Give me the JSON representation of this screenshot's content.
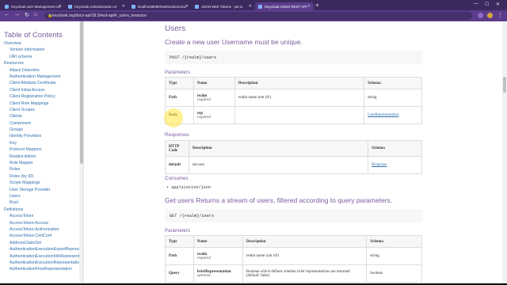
{
  "browser": {
    "tabs": [
      {
        "label": "Keycloak user Management Us",
        "active": false
      },
      {
        "label": "Keycloak Administration UI",
        "active": false
      },
      {
        "label": "localhost8090/realms/demo/ac",
        "active": false
      },
      {
        "label": "JSON Web Tokens - jwt.io",
        "active": false
      },
      {
        "label": "Keycloak Admin REST API",
        "active": true
      }
    ],
    "url": "keycloak.org/docs-api/18.0/rest-api/#_users_resource"
  },
  "sidebar": {
    "title": "Table of Contents",
    "items": [
      {
        "label": "Overview",
        "level": 1
      },
      {
        "label": "Version information",
        "level": 2
      },
      {
        "label": "URI scheme",
        "level": 2
      },
      {
        "label": "Resources",
        "level": 1
      },
      {
        "label": "Attack Detection",
        "level": 2
      },
      {
        "label": "Authentication Management",
        "level": 2
      },
      {
        "label": "Client Attribute Certificate",
        "level": 2
      },
      {
        "label": "Client Initial Access",
        "level": 2
      },
      {
        "label": "Client Registration Policy",
        "level": 2
      },
      {
        "label": "Client Role Mappings",
        "level": 2
      },
      {
        "label": "Client Scopes",
        "level": 2
      },
      {
        "label": "Clients",
        "level": 2
      },
      {
        "label": "Component",
        "level": 2
      },
      {
        "label": "Groups",
        "level": 2
      },
      {
        "label": "Identity Providers",
        "level": 2
      },
      {
        "label": "Key",
        "level": 2
      },
      {
        "label": "Protocol Mappers",
        "level": 2
      },
      {
        "label": "Realms Admin",
        "level": 2
      },
      {
        "label": "Role Mapper",
        "level": 2
      },
      {
        "label": "Roles",
        "level": 2
      },
      {
        "label": "Roles (by ID)",
        "level": 2
      },
      {
        "label": "Scope Mappings",
        "level": 2
      },
      {
        "label": "User Storage Provider",
        "level": 2
      },
      {
        "label": "Users",
        "level": 2
      },
      {
        "label": "Root",
        "level": 2
      },
      {
        "label": "Definitions",
        "level": 1
      },
      {
        "label": "AccessToken",
        "level": 2
      },
      {
        "label": "AccessToken-Access",
        "level": 2
      },
      {
        "label": "AccessToken-Authorization",
        "level": 2
      },
      {
        "label": "AccessToken-CertConf",
        "level": 2
      },
      {
        "label": "AddressClaimSet",
        "level": 2
      },
      {
        "label": "AuthenticationExecutionExportRepresentation",
        "level": 2
      },
      {
        "label": "AuthenticationExecutionInfoRepresentation",
        "level": 2
      },
      {
        "label": "AuthenticationExecutionRepresentation",
        "level": 2
      },
      {
        "label": "AuthenticationFlowRepresentation",
        "level": 2
      }
    ]
  },
  "main": {
    "section_title": "Users",
    "create": {
      "title": "Create a new user Username must be unique.",
      "endpoint": "POST /{realm}/users",
      "params_title": "Parameters",
      "params_headers": [
        "Type",
        "Name",
        "Description",
        "Schema"
      ],
      "params_rows": [
        {
          "type": "Path",
          "name": "realm",
          "required": "required",
          "description": "realm name (not id!)",
          "schema": "string"
        },
        {
          "type": "Body",
          "name": "rep",
          "required": "required",
          "description": "",
          "schema": "UserRepresentation"
        }
      ],
      "responses_title": "Responses",
      "responses_headers": [
        "HTTP Code",
        "Description",
        "Schema"
      ],
      "responses_rows": [
        {
          "code": "default",
          "description": "success",
          "schema": "Response"
        }
      ],
      "consumes_title": "Consumes",
      "consumes": "application/json"
    },
    "get": {
      "title": "Get users Returns a stream of users, filtered according to query parameters.",
      "endpoint": "GET /{realm}/users",
      "params_title": "Parameters",
      "params_headers": [
        "Type",
        "Name",
        "Description",
        "Schema"
      ],
      "params_rows": [
        {
          "type": "Path",
          "name": "realm",
          "required": "required",
          "description": "realm name (not id!)",
          "schema": "string"
        },
        {
          "type": "Query",
          "name": "briefRepresentation",
          "required": "optional",
          "description": "Boolean which defines whether brief representations are returned (default: false)",
          "schema": "boolean"
        }
      ]
    }
  }
}
